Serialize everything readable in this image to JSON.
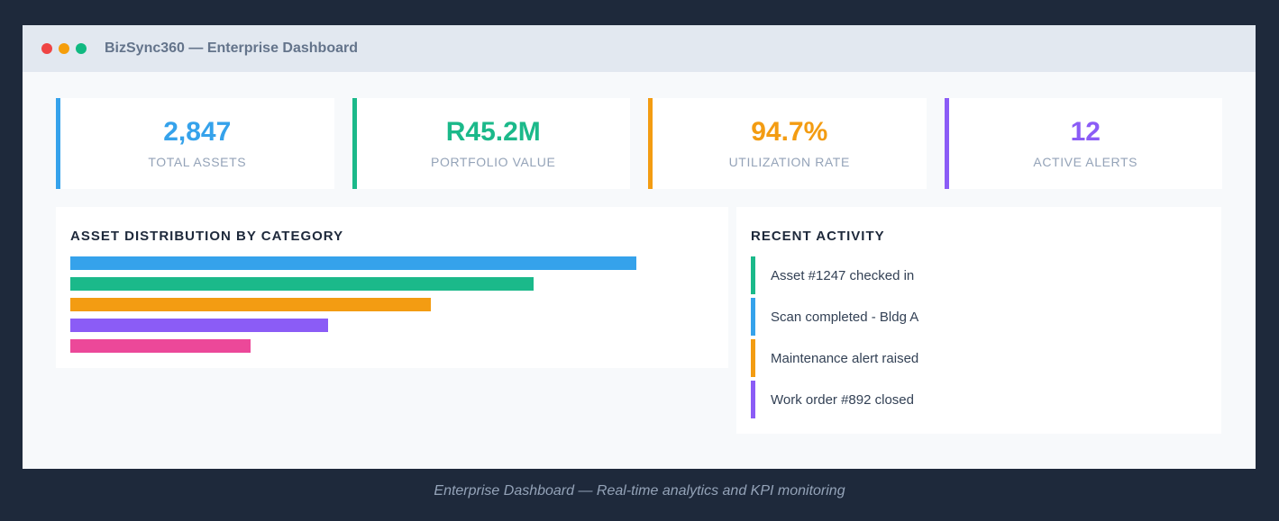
{
  "window": {
    "title": "BizSync360 — Enterprise Dashboard",
    "controls": [
      {
        "name": "close",
        "color": "#ef4444"
      },
      {
        "name": "minimize",
        "color": "#f59e0b"
      },
      {
        "name": "maximize",
        "color": "#10b981"
      }
    ]
  },
  "kpis": [
    {
      "value": "2,847",
      "label": "TOTAL ASSETS",
      "color": "#35a2eb"
    },
    {
      "value": "R45.2M",
      "label": "PORTFOLIO VALUE",
      "color": "#1bb98a"
    },
    {
      "value": "94.7%",
      "label": "UTILIZATION RATE",
      "color": "#f39c12"
    },
    {
      "value": "12",
      "label": "ACTIVE ALERTS",
      "color": "#8b5cf6"
    }
  ],
  "distribution": {
    "title": "ASSET DISTRIBUTION BY CATEGORY",
    "bars": [
      {
        "fraction": 0.88,
        "color": "#35a2eb"
      },
      {
        "fraction": 0.72,
        "color": "#1bb98a"
      },
      {
        "fraction": 0.56,
        "color": "#f39c12"
      },
      {
        "fraction": 0.4,
        "color": "#8b5cf6"
      },
      {
        "fraction": 0.28,
        "color": "#ec4899"
      }
    ]
  },
  "activity": {
    "title": "RECENT ACTIVITY",
    "items": [
      {
        "text": "Asset #1247 checked in",
        "color": "#1bb98a"
      },
      {
        "text": "Scan completed - Bldg A",
        "color": "#35a2eb"
      },
      {
        "text": "Maintenance alert raised",
        "color": "#f39c12"
      },
      {
        "text": "Work order #892 closed",
        "color": "#8b5cf6"
      }
    ]
  },
  "caption": "Enterprise Dashboard — Real-time analytics and KPI monitoring"
}
